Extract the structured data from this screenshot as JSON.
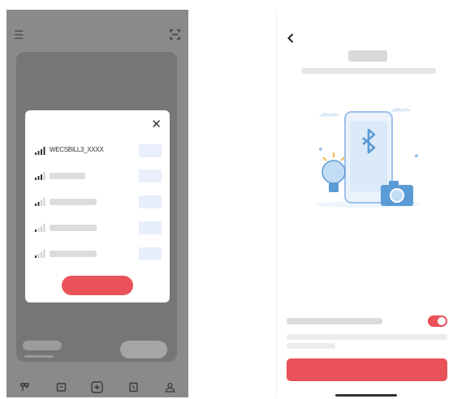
{
  "colors": {
    "accent": "#ea5259",
    "overlay": "#8a8a8a",
    "chip": "#e8eefb",
    "illustration_blue": "#5b9bd5"
  },
  "left_screen": {
    "header": {
      "menu_icon": "hamburger-menu-icon",
      "scan_icon": "scan-icon"
    },
    "wifi_dialog": {
      "close_icon": "close-icon",
      "networks": [
        {
          "ssid": "WECSBILL3_XXXX",
          "signal": 4
        },
        {
          "ssid": "",
          "signal": 3
        },
        {
          "ssid": "",
          "signal": 2
        },
        {
          "ssid": "",
          "signal": 1
        },
        {
          "ssid": "",
          "signal": 1
        }
      ]
    },
    "bottom_nav": [
      "device-icon",
      "box-icon",
      "add-icon",
      "document-icon",
      "profile-icon"
    ]
  },
  "right_screen": {
    "back_icon": "back-chevron-icon",
    "illustration": "bluetooth-phone-illustration",
    "toggle": {
      "on": true
    }
  }
}
